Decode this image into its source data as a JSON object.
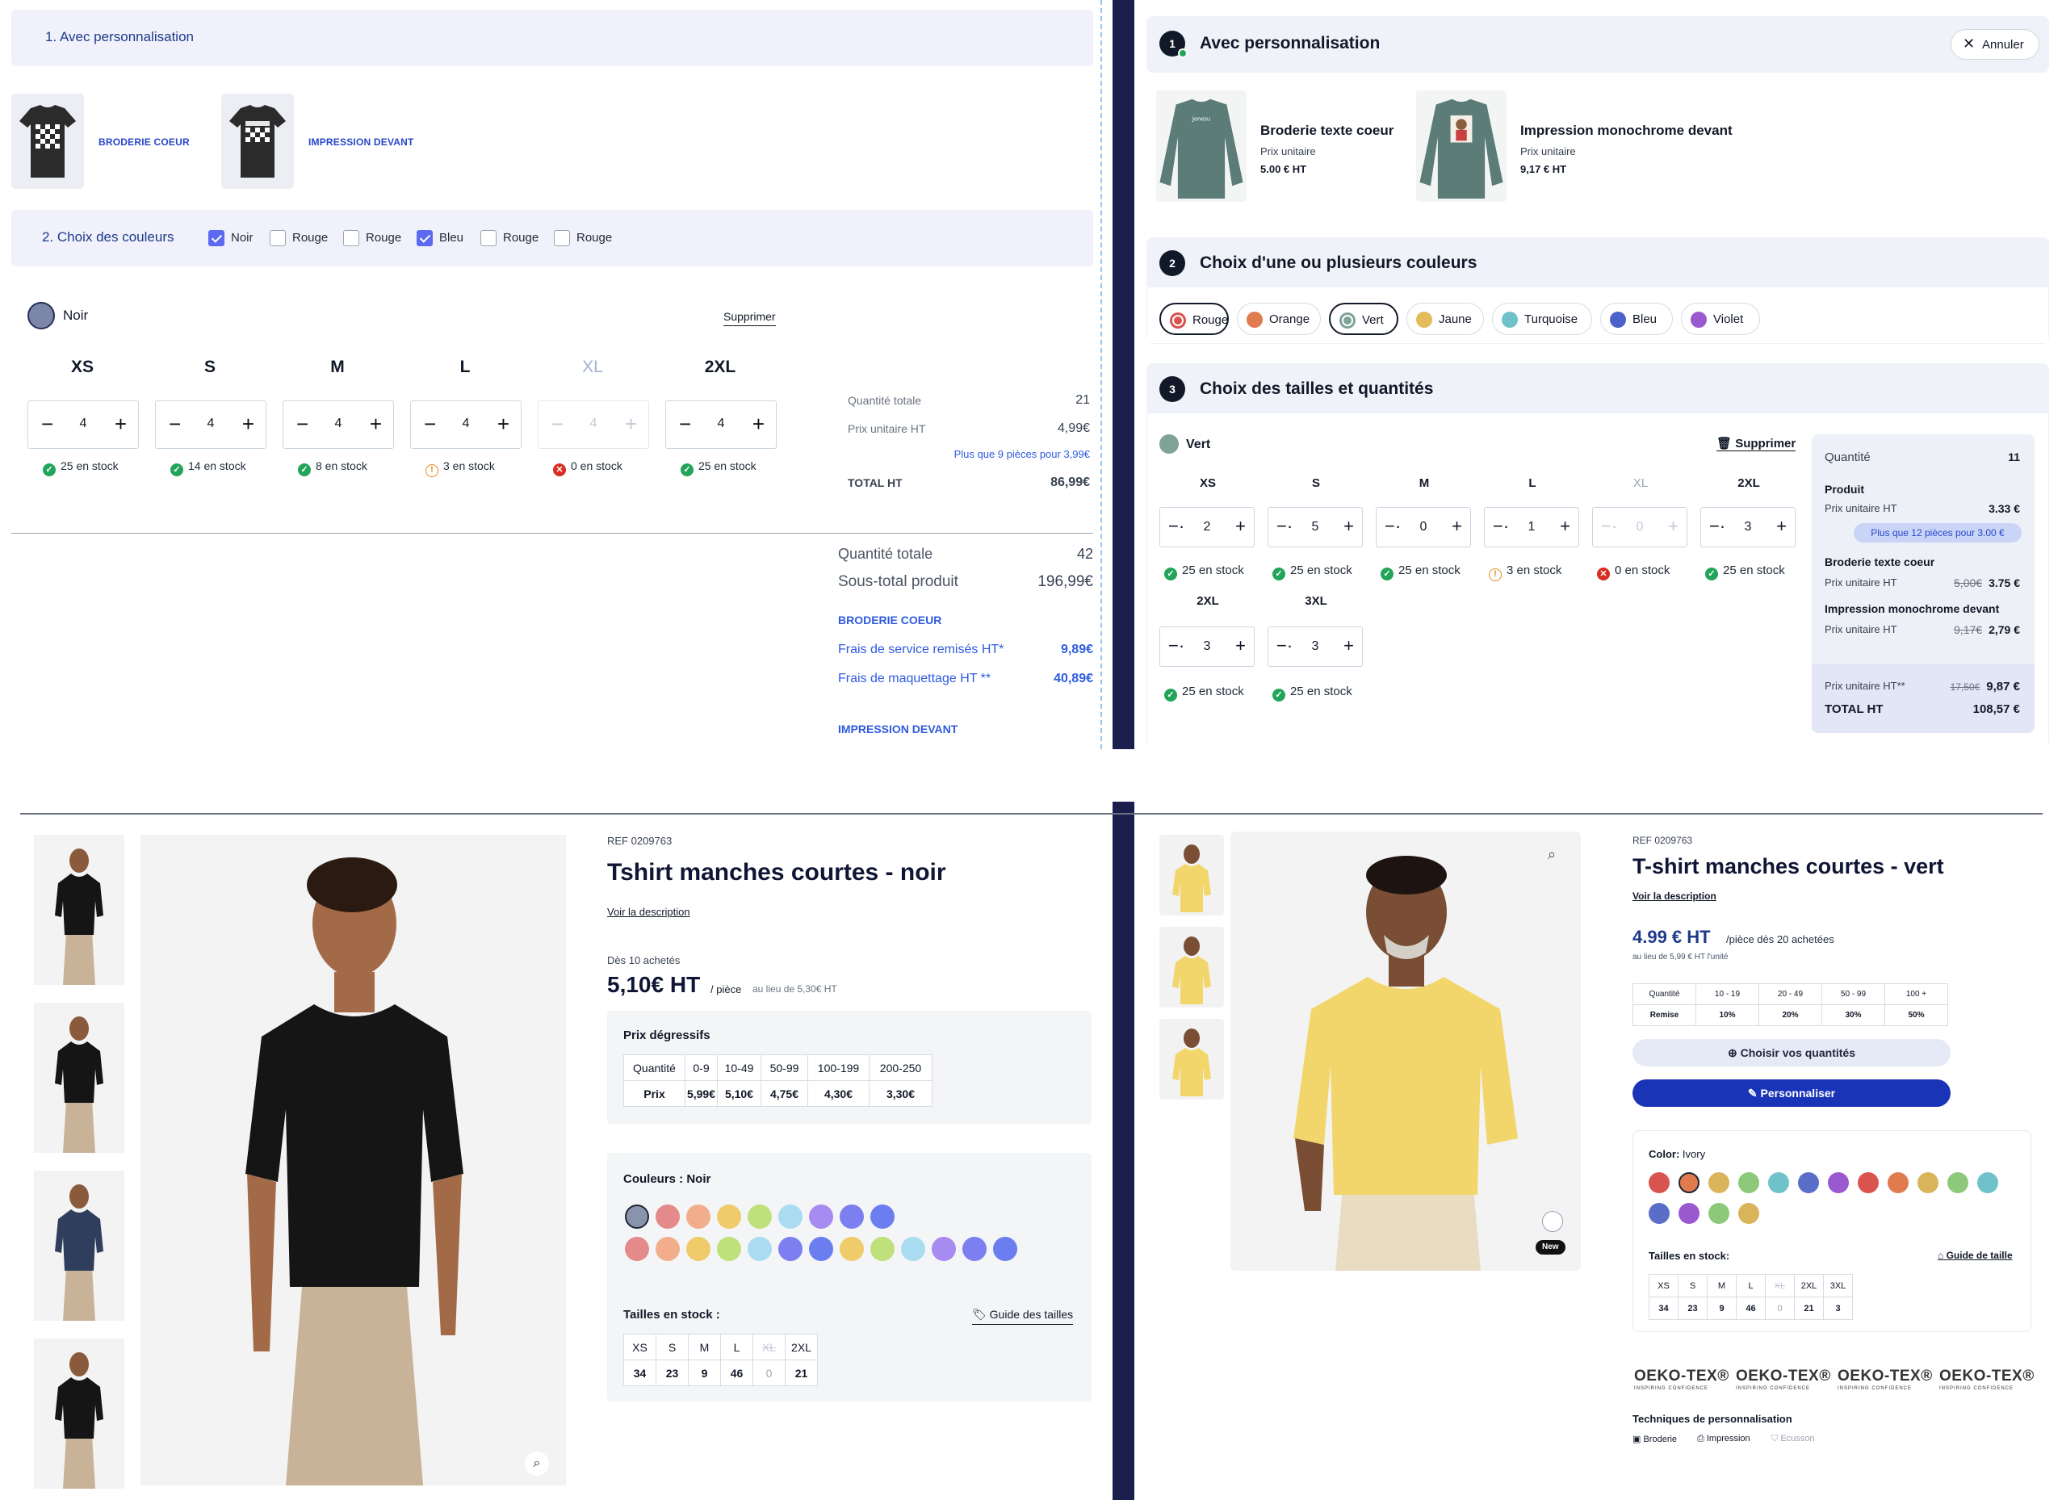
{
  "panelA": {
    "step1_title": "1. Avec personnalisation",
    "tiles": [
      {
        "label": "BRODERIE COEUR",
        "icon": "tshirt-checker-icon"
      },
      {
        "label": "IMPRESSION DEVANT",
        "icon": "tshirt-checker-icon"
      }
    ],
    "step2_title": "2. Choix des couleurs",
    "color_checkboxes": [
      {
        "label": "Noir",
        "checked": true
      },
      {
        "label": "Rouge",
        "checked": false
      },
      {
        "label": "Rouge",
        "checked": false
      },
      {
        "label": "Bleu",
        "checked": true
      },
      {
        "label": "Rouge",
        "checked": false
      },
      {
        "label": "Rouge",
        "checked": false
      }
    ],
    "selected_color": "Noir",
    "selected_color_hex": "#7b86a8",
    "remove_label": "Supprimer",
    "sizes": [
      {
        "size": "XS",
        "qty": "4",
        "stock": "25 en stock",
        "status": "ok",
        "disabled": false
      },
      {
        "size": "S",
        "qty": "4",
        "stock": "14 en stock",
        "status": "ok",
        "disabled": false
      },
      {
        "size": "M",
        "qty": "4",
        "stock": "8 en stock",
        "status": "ok",
        "disabled": false
      },
      {
        "size": "L",
        "qty": "4",
        "stock": "3 en stock",
        "status": "warn",
        "disabled": false
      },
      {
        "size": "XL",
        "qty": "4",
        "stock": "0 en stock",
        "status": "ko",
        "disabled": true
      },
      {
        "size": "2XL",
        "qty": "4",
        "stock": "25 en stock",
        "status": "ok",
        "disabled": false
      }
    ],
    "summary": {
      "qty_label": "Quantité totale",
      "qty_value": "21",
      "unit_label": "Prix unitaire HT",
      "unit_value": "4,99€",
      "promo": "Plus que 9 pièces pour 3,99€",
      "total_label": "TOTAL HT",
      "total_value": "86,99€"
    },
    "footer": {
      "qty_label": "Quantité totale",
      "qty_value": "42",
      "subtotal_label": "Sous-total produit",
      "subtotal_value": "196,99€",
      "section1": "BRODERIE COEUR",
      "service_label": "Frais de service remisés HT*",
      "service_value": "9,89€",
      "mockup_label": "Frais de maquettage HT **",
      "mockup_value": "40,89€",
      "section2": "IMPRESSION DEVANT"
    }
  },
  "panelB": {
    "step1": {
      "num": "1",
      "title": "Avec personnalisation",
      "cancel": "Annuler"
    },
    "options": [
      {
        "name": "Broderie texte coeur",
        "unit_label": "Prix unitaire",
        "price": "5.00 € HT"
      },
      {
        "name": "Impression monochrome devant",
        "unit_label": "Prix unitaire",
        "price": "9,17 € HT"
      }
    ],
    "step2": {
      "num": "2",
      "title": "Choix d'une ou plusieurs couleurs"
    },
    "colors": [
      {
        "label": "Rouge",
        "hex": "#d9534f",
        "selected": true
      },
      {
        "label": "Orange",
        "hex": "#e07a4f",
        "selected": false
      },
      {
        "label": "Vert",
        "hex": "#7fa399",
        "selected": true
      },
      {
        "label": "Jaune",
        "hex": "#e3bb5a",
        "selected": false
      },
      {
        "label": "Turquoise",
        "hex": "#6fc2c9",
        "selected": false
      },
      {
        "label": "Bleu",
        "hex": "#4a62c9",
        "selected": false
      },
      {
        "label": "Violet",
        "hex": "#9b59d0",
        "selected": false
      }
    ],
    "step3": {
      "num": "3",
      "title": "Choix des tailles et quantités"
    },
    "selected_color": "Vert",
    "remove_label": "Supprimer",
    "sizes": [
      {
        "size": "XS",
        "qty": "2",
        "stock": "25 en stock",
        "status": "ok",
        "disabled": false
      },
      {
        "size": "S",
        "qty": "5",
        "stock": "25 en stock",
        "status": "ok",
        "disabled": false
      },
      {
        "size": "M",
        "qty": "0",
        "stock": "25 en stock",
        "status": "ok",
        "disabled": false
      },
      {
        "size": "L",
        "qty": "1",
        "stock": "3 en stock",
        "status": "warn",
        "disabled": false
      },
      {
        "size": "XL",
        "qty": "0",
        "stock": "0 en stock",
        "status": "ko",
        "disabled": true
      },
      {
        "size": "2XL",
        "qty": "3",
        "stock": "25 en stock",
        "status": "ok",
        "disabled": false
      },
      {
        "size": "2XL",
        "qty": "3",
        "stock": "25 en stock",
        "status": "ok",
        "disabled": false
      },
      {
        "size": "3XL",
        "qty": "3",
        "stock": "25 en stock",
        "status": "ok",
        "disabled": false
      }
    ],
    "summary": {
      "qty_label": "Quantité",
      "qty_value": "11",
      "product_label": "Produit",
      "unit_label": "Prix unitaire HT",
      "product_price": "3.33 €",
      "promo": "Plus que 12 pièces pour 3.00 €",
      "opt1_label": "Broderie texte coeur",
      "opt1_old": "5,00€",
      "opt1_price": "3.75 €",
      "opt2_label": "Impression monochrome devant",
      "opt2_old": "9,17€",
      "opt2_price": "2,79 €",
      "unit_total_label": "Prix unitaire HT**",
      "unit_total_old": "17,50€",
      "unit_total_price": "9,87 €",
      "total_label": "TOTAL HT",
      "total_value": "108,57 €"
    }
  },
  "panelC": {
    "ref": "REF 0209763",
    "title": "Tshirt manches courtes - noir",
    "desc_link": "Voir la description",
    "from_label": "Dès 10 achetés",
    "price": "5,10€ HT",
    "per_piece": "/ pièce",
    "was": "au lieu de 5,30€ HT",
    "tiers_title": "Prix dégressifs",
    "tiers_head": [
      "Quantité",
      "0-9",
      "10-49",
      "50-99",
      "100-199",
      "200-250"
    ],
    "tiers_row": [
      "Prix",
      "5,99€",
      "5,10€",
      "4,75€",
      "4,30€",
      "3,30€"
    ],
    "colors_title": "Couleurs : Noir",
    "swatches_row1": [
      "#8a93ae",
      "#e48a8a",
      "#f2ae8c",
      "#efcb6a",
      "#bfe07a",
      "#a9dcf0",
      "#a78bf0",
      "#7b7ff0",
      "#6a7ef0"
    ],
    "swatches_row2": [
      "#e48a8a",
      "#f2ae8c",
      "#efcb6a",
      "#bfe07a",
      "#a9dcf0",
      "#7b7ff0",
      "#6a7ef0",
      "#efcb6a",
      "#bfe07a",
      "#a9dcf0",
      "#a78bf0",
      "#7b7ff0",
      "#6a7ef0"
    ],
    "sizes_title": "Tailles en stock :",
    "guide": "Guide des tailles",
    "stock_sizes": [
      "XS",
      "S",
      "M",
      "L",
      "XL",
      "2XL"
    ],
    "stock_values": [
      "34",
      "23",
      "9",
      "46",
      "0",
      "21"
    ]
  },
  "panelD": {
    "ref": "REF 0209763",
    "title": "T-shirt manches courtes - vert",
    "desc_link": "Voir la description",
    "price": "4.99 € HT",
    "per": "/pièce dès 20 achetées",
    "was": "au lieu de 5,99 € HT l'unité",
    "tiers_head": [
      "Quantité",
      "10 - 19",
      "20 - 49",
      "50 - 99",
      "100 +"
    ],
    "tiers_row": [
      "Remise",
      "10%",
      "20%",
      "30%",
      "50%"
    ],
    "choose_qty": "Choisir vos quantités",
    "personalize": "Personnaliser",
    "color_label": "Color:",
    "color_value": "Ivory",
    "swatches_row1": [
      "#d9534f",
      "#e07a4f",
      "#d9b45a",
      "#8cc97a",
      "#6fc2c9",
      "#5a6ec9",
      "#9b59d0",
      "#d9534f",
      "#e07a4f",
      "#d9b45a",
      "#8cc97a",
      "#6fc2c9"
    ],
    "swatches_row2": [
      "#5a6ec9",
      "#9b59d0",
      "#8cc97a",
      "#d9b45a"
    ],
    "sizes_title": "Tailles en stock:",
    "guide": "Guide de taille",
    "stock_sizes": [
      "XS",
      "S",
      "M",
      "L",
      "XL",
      "2XL",
      "3XL"
    ],
    "stock_values": [
      "34",
      "23",
      "9",
      "46",
      "0",
      "21",
      "3"
    ],
    "new_badge": "New",
    "oeko": [
      "OEKO-TEX®",
      "OEKO-TEX®",
      "OEKO-TEX®",
      "OEKO-TEX®"
    ],
    "oeko_sub": "INSPIRING CONFIDENCE",
    "techniques_title": "Techniques de personnalisation",
    "techniques": [
      "Broderie",
      "Impression",
      "Ecusson"
    ]
  }
}
